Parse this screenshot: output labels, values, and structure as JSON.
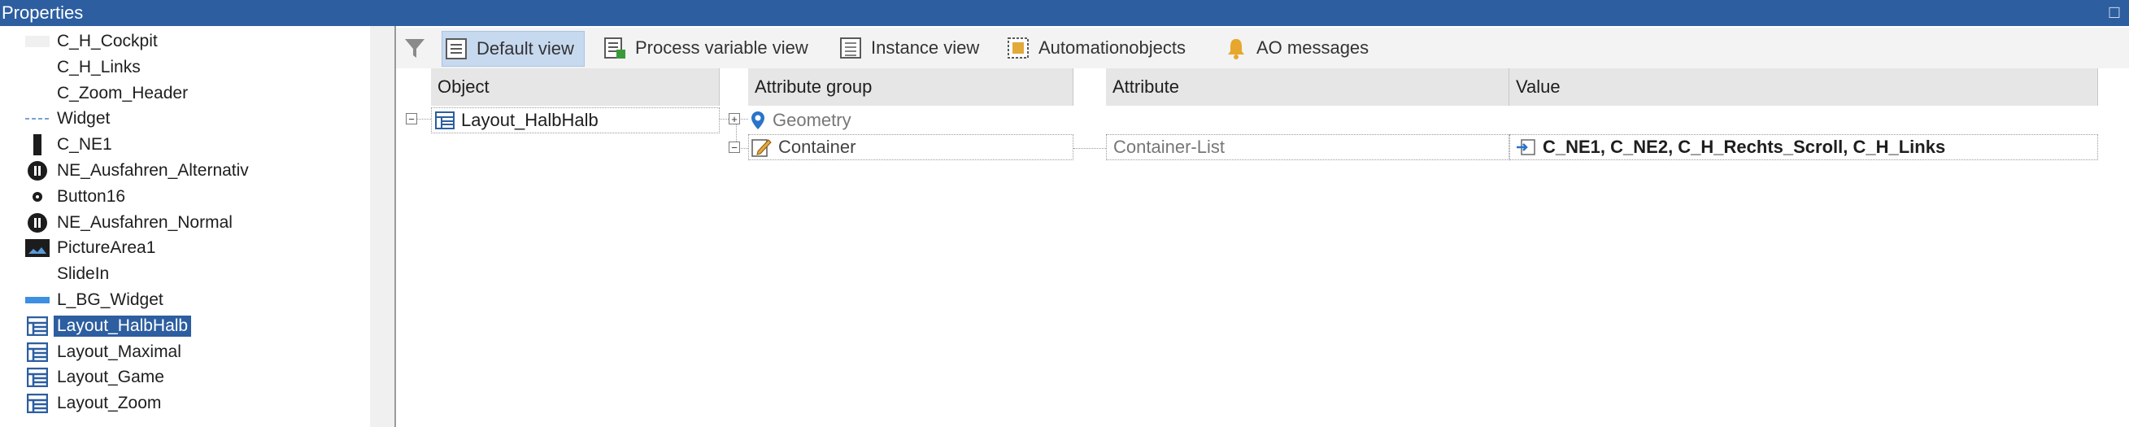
{
  "window": {
    "title": "Properties",
    "pin_glyph": "☐"
  },
  "tree": {
    "items": [
      {
        "label": "C_H_Cockpit",
        "icon": "blank-swatch-icon"
      },
      {
        "label": "C_H_Links",
        "icon": "none"
      },
      {
        "label": "C_Zoom_Header",
        "icon": "none"
      },
      {
        "label": "Widget",
        "icon": "dashed-line-icon"
      },
      {
        "label": "C_NE1",
        "icon": "vertical-bar-icon"
      },
      {
        "label": "NE_Ausfahren_Alternativ",
        "icon": "round-button-icon"
      },
      {
        "label": "Button16",
        "icon": "small-gear-icon"
      },
      {
        "label": "NE_Ausfahren_Normal",
        "icon": "round-button-icon"
      },
      {
        "label": "PictureArea1",
        "icon": "picture-icon"
      },
      {
        "label": "SlideIn",
        "icon": "none"
      },
      {
        "label": "L_BG_Widget",
        "icon": "blue-bar-icon"
      },
      {
        "label": "Layout_HalbHalb",
        "icon": "layout-icon",
        "selected": true
      },
      {
        "label": "Layout_Maximal",
        "icon": "layout-icon"
      },
      {
        "label": "Layout_Game",
        "icon": "layout-icon"
      },
      {
        "label": "Layout_Zoom",
        "icon": "layout-icon"
      }
    ]
  },
  "toolbar": {
    "filter_icon": "filter-icon",
    "default_view": "Default view",
    "process_variable_view": "Process variable view",
    "instance_view": "Instance view",
    "automationobjects": "Automationobjects",
    "ao_messages": "AO messages"
  },
  "grid": {
    "headers": {
      "object": "Object",
      "attribute_group": "Attribute group",
      "attribute": "Attribute",
      "value": "Value"
    },
    "object_row": {
      "expander": "−",
      "label": "Layout_HalbHalb"
    },
    "groups": [
      {
        "expander": "+",
        "label": "Geometry",
        "icon": "location-pin-icon"
      },
      {
        "expander": "−",
        "label": "Container",
        "icon": "edit-icon"
      }
    ],
    "attribute_row": {
      "attribute": "Container-List",
      "value": "C_NE1, C_NE2, C_H_Rechts_Scroll, C_H_Links"
    }
  },
  "colors": {
    "accent": "#2c5ea0",
    "selected_tab": "#c7d9ef",
    "header_bg": "#e6e6e6",
    "toolbar_bg": "#f3f3f3"
  }
}
